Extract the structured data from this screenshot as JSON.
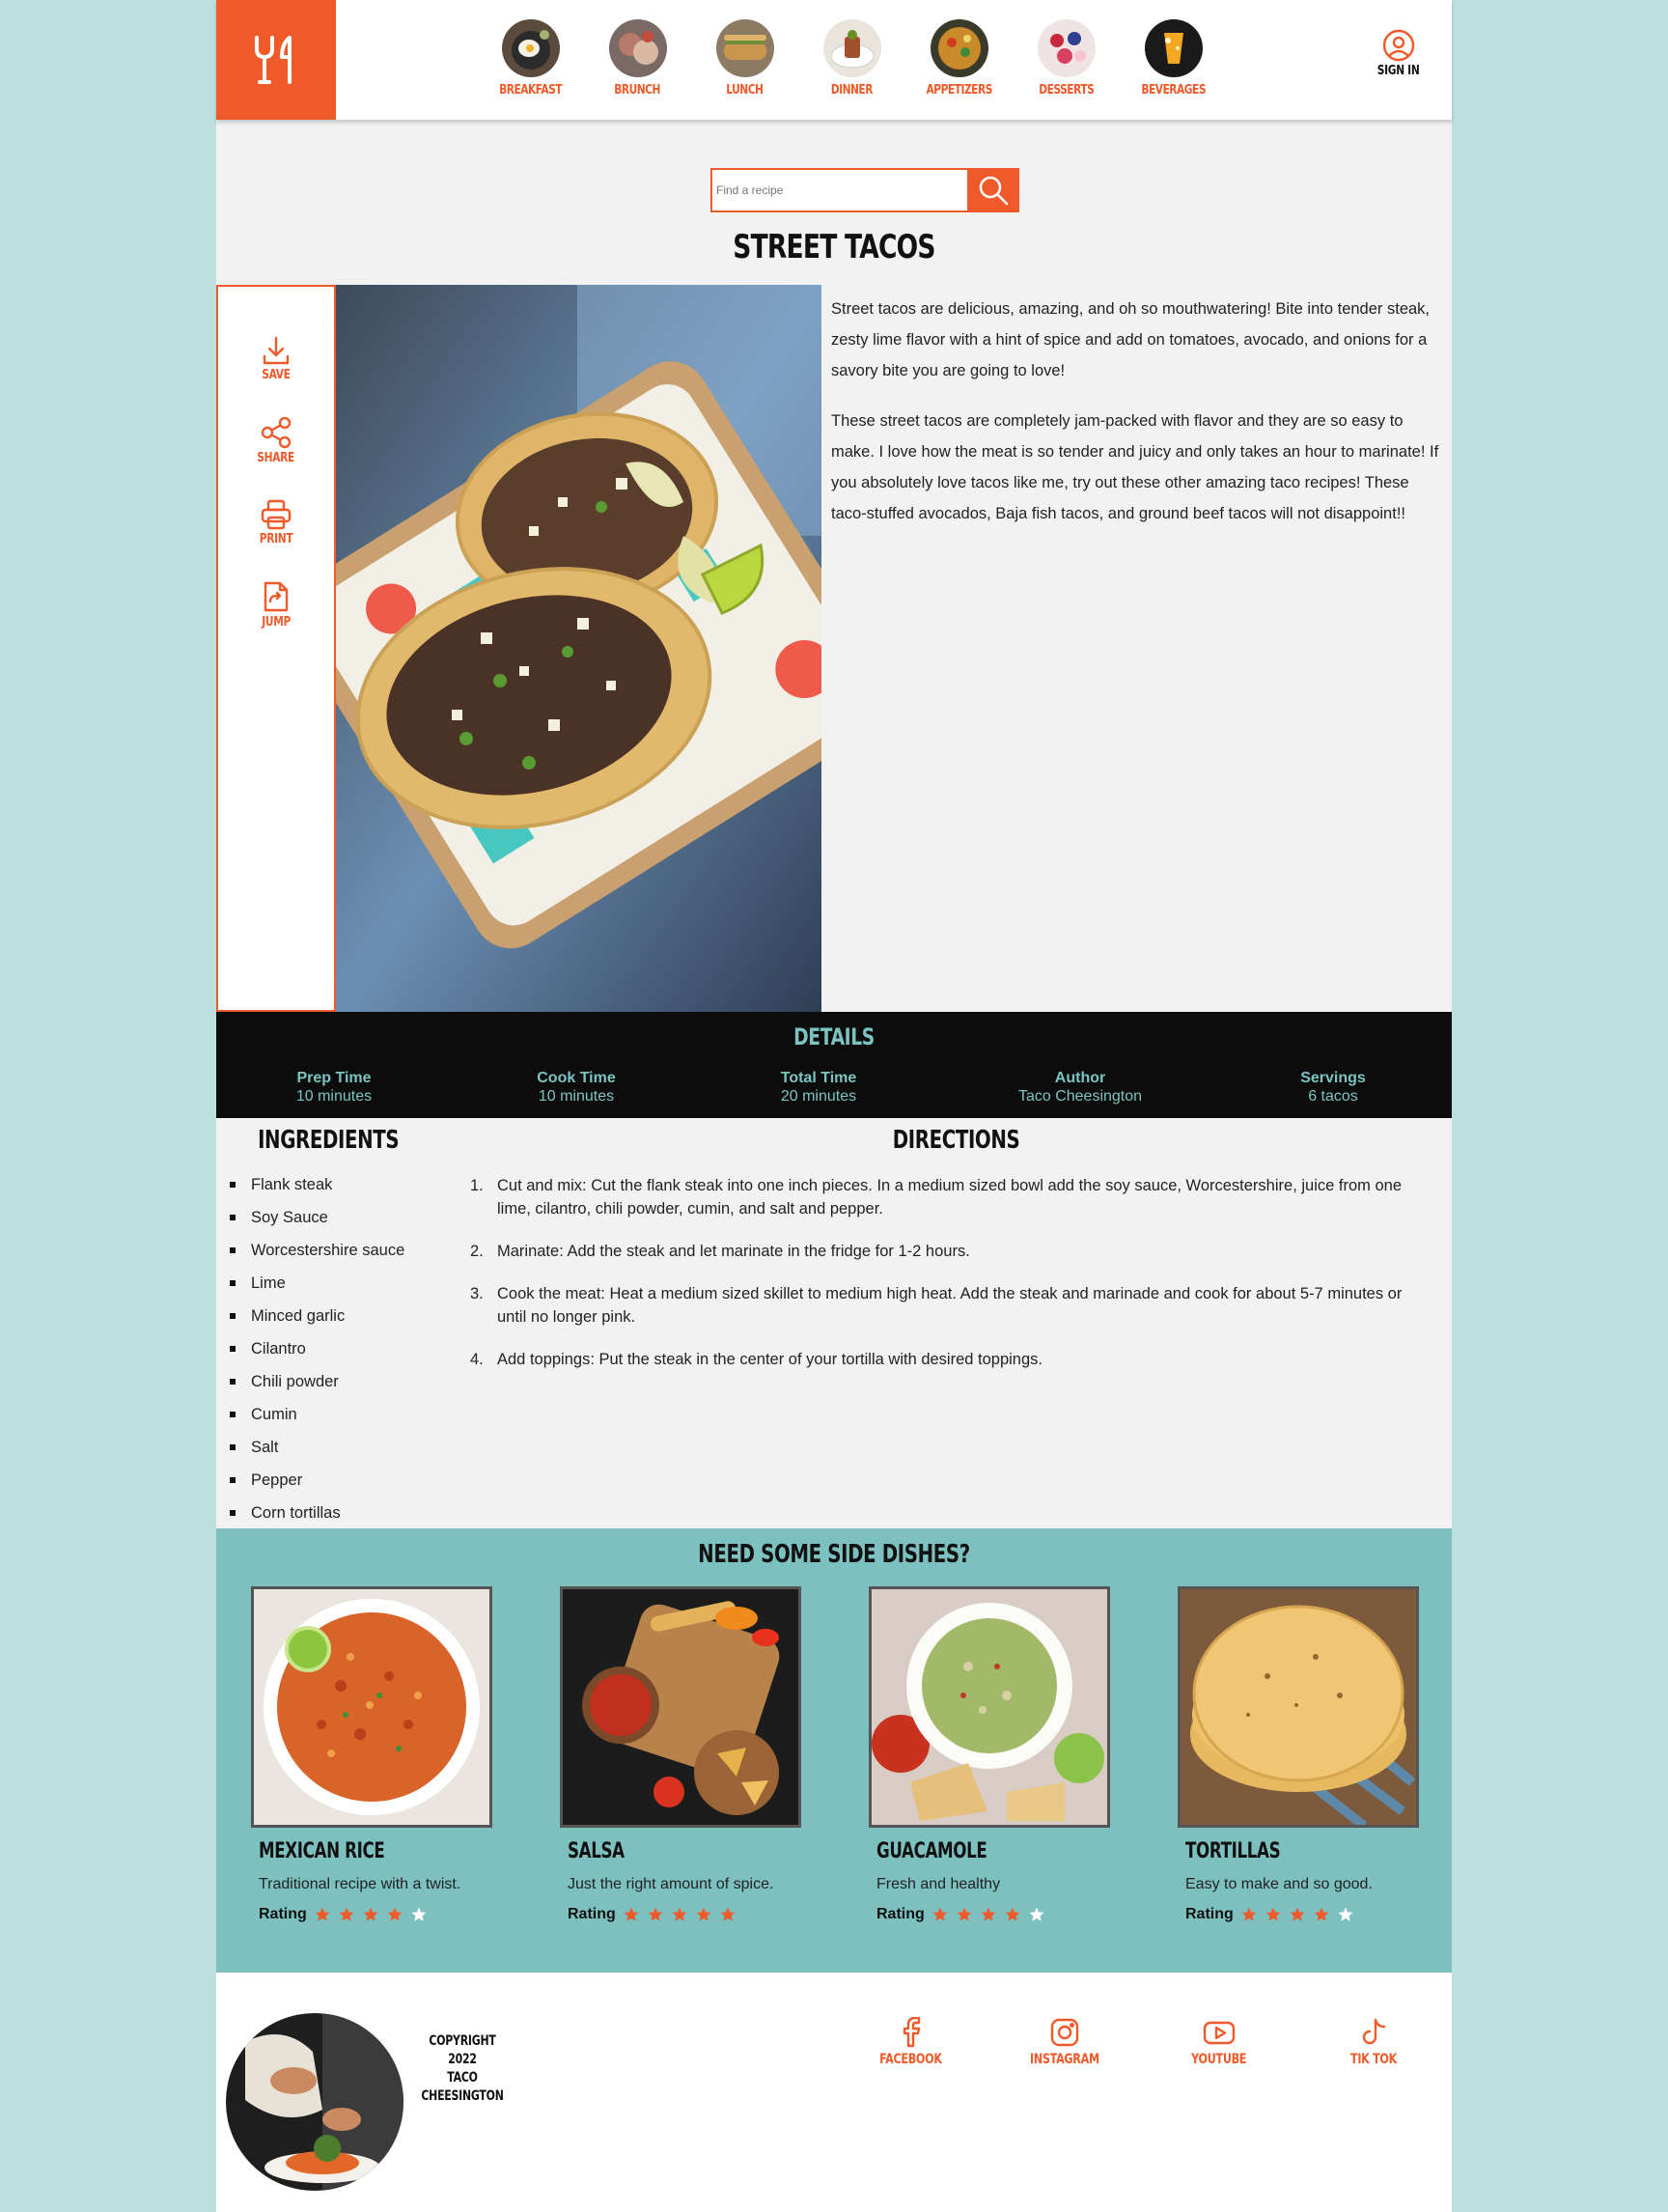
{
  "nav": {
    "items": [
      {
        "label": "BREAKFAST"
      },
      {
        "label": "BRUNCH"
      },
      {
        "label": "LUNCH"
      },
      {
        "label": "DINNER"
      },
      {
        "label": "APPETIZERS"
      },
      {
        "label": "DESSERTS"
      },
      {
        "label": "BEVERAGES"
      }
    ],
    "sign_in": "SIGN IN"
  },
  "search": {
    "placeholder": "Find a recipe"
  },
  "recipe": {
    "title": "STREET TACOS",
    "description": [
      "Street tacos are delicious, amazing, and oh so mouthwatering! Bite into tender steak, zesty lime flavor with a hint of spice and add on tomatoes, avocado, and onions for a savory bite you are going to love!",
      "These street tacos are completely jam-packed with flavor and they are so easy to make. I love how the meat is so tender and juicy and only takes an hour to marinate! If you absolutely love tacos like me, try out these other amazing taco recipes! These taco-stuffed avocados, Baja fish tacos, and ground beef tacos will not disappoint!!"
    ]
  },
  "actions": {
    "save": "SAVE",
    "share": "SHARE",
    "print": "PRINT",
    "jump": "JUMP"
  },
  "details": {
    "title": "DETAILS",
    "items": [
      {
        "label": "Prep Time",
        "value": "10 minutes"
      },
      {
        "label": "Cook Time",
        "value": "10 minutes"
      },
      {
        "label": "Total Time",
        "value": "20 minutes"
      },
      {
        "label": "Author",
        "value": "Taco Cheesington"
      },
      {
        "label": "Servings",
        "value": "6 tacos"
      }
    ]
  },
  "ingredients": {
    "title": "INGREDIENTS",
    "items": [
      "Flank steak",
      "Soy Sauce",
      "Worcestershire sauce",
      "Lime",
      "Minced garlic",
      "Cilantro",
      "Chili powder",
      "Cumin",
      "Salt",
      "Pepper",
      "Corn tortillas"
    ]
  },
  "directions": {
    "title": "DIRECTIONS",
    "steps": [
      {
        "num": "1.",
        "text": "Cut and mix: Cut the flank steak into one inch pieces. In a medium sized bowl add the soy sauce, Worcestershire, juice from one lime, cilantro, chili powder, cumin, and salt and pepper."
      },
      {
        "num": "2.",
        "text": "Marinate: Add the steak and let marinate in the fridge for 1-2 hours."
      },
      {
        "num": "3.",
        "text": "Cook the meat: Heat a medium sized skillet to medium high heat. Add the steak and marinade and cook for about 5-7 minutes or until no longer pink."
      },
      {
        "num": "4.",
        "text": "Add toppings: Put the steak in the center of your tortilla with desired toppings."
      }
    ]
  },
  "sides": {
    "title": "NEED SOME SIDE DISHES?",
    "rating_label": "Rating",
    "cards": [
      {
        "name": "MEXICAN RICE",
        "desc": "Traditional recipe with a twist.",
        "rating": 4
      },
      {
        "name": "SALSA",
        "desc": "Just the right amount of spice.",
        "rating": 5
      },
      {
        "name": "GUACAMOLE",
        "desc": "Fresh and healthy",
        "rating": 4
      },
      {
        "name": "TORTILLAS",
        "desc": "Easy to make and so good.",
        "rating": 4
      }
    ]
  },
  "footer": {
    "copyright_line1": "COPYRIGHT 2022",
    "copyright_line2": "TACO CHEESINGTON",
    "social": [
      "FACEBOOK",
      "INSTAGRAM",
      "YOUTUBE",
      "TIK TOK"
    ]
  },
  "colors": {
    "accent": "#ee5a2a",
    "teal": "#7cc1c0",
    "details_bg": "#0c0c0c",
    "page_bg": "#bcdfe0"
  }
}
